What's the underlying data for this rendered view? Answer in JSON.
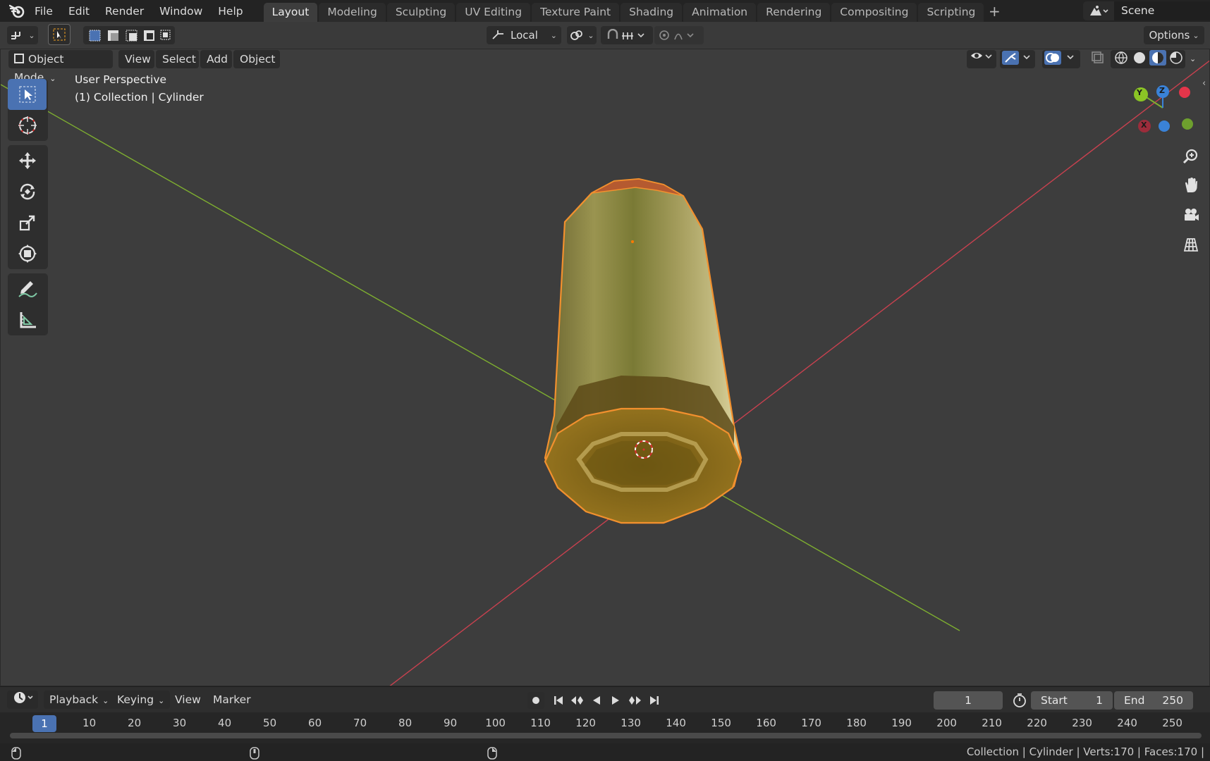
{
  "menu": {
    "items": [
      "File",
      "Edit",
      "Render",
      "Window",
      "Help"
    ]
  },
  "workspaces": {
    "tabs": [
      "Layout",
      "Modeling",
      "Sculpting",
      "UV Editing",
      "Texture Paint",
      "Shading",
      "Animation",
      "Rendering",
      "Compositing",
      "Scripting"
    ],
    "active": "Layout"
  },
  "scene": {
    "name": "Scene"
  },
  "tool_header": {
    "transform_orientation": "Local",
    "options_label": "Options"
  },
  "viewport_header": {
    "mode": "Object Mode",
    "menus": [
      "View",
      "Select",
      "Add",
      "Object"
    ]
  },
  "viewport": {
    "info_line1": "User Perspective",
    "info_line2": "(1) Collection | Cylinder",
    "gizmo_axes": {
      "x": "X",
      "y": "Y",
      "z": "Z"
    }
  },
  "colors": {
    "accent": "#4a72b2",
    "x_axis": "#c8414f",
    "y_axis": "#7eae30",
    "z_axis": "#3a82d7",
    "selection_outline": "#f2902e"
  },
  "timeline": {
    "menus": [
      "Playback",
      "Keying",
      "View",
      "Marker"
    ],
    "current_frame": "1",
    "start_label": "Start",
    "start_value": "1",
    "end_label": "End",
    "end_value": "250",
    "ruler_ticks": [
      "1",
      "10",
      "20",
      "30",
      "40",
      "50",
      "60",
      "70",
      "80",
      "90",
      "100",
      "110",
      "120",
      "130",
      "140",
      "150",
      "160",
      "170",
      "180",
      "190",
      "200",
      "210",
      "220",
      "230",
      "240",
      "250"
    ]
  },
  "status": {
    "text": "Collection | Cylinder | Verts:170 | Faces:170 |"
  }
}
